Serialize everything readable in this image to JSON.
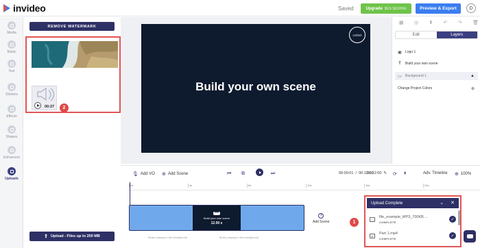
{
  "app": {
    "name": "invideo",
    "status": "Saved"
  },
  "header": {
    "upgrade_label": "Upgrade",
    "upgrade_price": "$15 $10/mo",
    "preview_label": "Preview & Export",
    "avatar_initial": "D"
  },
  "sidebar": {
    "items": [
      {
        "label": "Media",
        "icon": "media-icon"
      },
      {
        "label": "Music",
        "icon": "music-icon"
      },
      {
        "label": "Text",
        "icon": "text-icon"
      },
      {
        "label": "Stickers",
        "icon": "stickers-icon"
      },
      {
        "label": "Effects",
        "icon": "effects-icon"
      },
      {
        "label": "Shapes",
        "icon": "shapes-icon"
      },
      {
        "label": "Enhancers",
        "icon": "enhancers-icon"
      },
      {
        "label": "Uploads",
        "icon": "uploads-icon",
        "active": true
      }
    ]
  },
  "uploads_panel": {
    "remove_watermark": "REMOVE WATERMARK",
    "video_duration": "00:27",
    "badge_2": "2",
    "upload_button": "Upload - Files up to 200 MB"
  },
  "canvas": {
    "title": "Build your own scene",
    "logo": "LOGO",
    "background": "#0e1a2e"
  },
  "right_panel": {
    "tabs": [
      {
        "label": "Edit"
      },
      {
        "label": "Layers",
        "active": true
      }
    ],
    "layers": [
      "Logo 1",
      "Build your own scene",
      "Background 1"
    ],
    "change_colors": "Change Project Colors"
  },
  "timeline": {
    "add_vo": "Add VO",
    "add_scene": "Add Scene",
    "time_current": "00:00:01",
    "time_total": "00:12:00",
    "time_end": "00:12:00",
    "adv_timeline": "Adv. Timeline",
    "zoom": "100%",
    "ruler": [
      "0s",
      "4s",
      "8s",
      "12s",
      "16s",
      "20s"
    ],
    "scene_thumb_title": "Build your own scene",
    "scene_thumb_time": "12.00 s",
    "audio_placeholder": "Music playing in the background",
    "add_scene_inline": "Add Scene"
  },
  "upload_popup": {
    "title": "Upload Complete",
    "badge_1": "1",
    "files": [
      {
        "name": "file_example_MP3_700KB....",
        "status": "COMPLETE",
        "type": "audio"
      },
      {
        "name": "Part 1.mp4",
        "status": "COMPLETE",
        "type": "video"
      }
    ]
  },
  "colors": {
    "accent": "#2e3066",
    "upgrade": "#6fc34a",
    "preview": "#3b7df0",
    "highlight": "#e05454"
  }
}
